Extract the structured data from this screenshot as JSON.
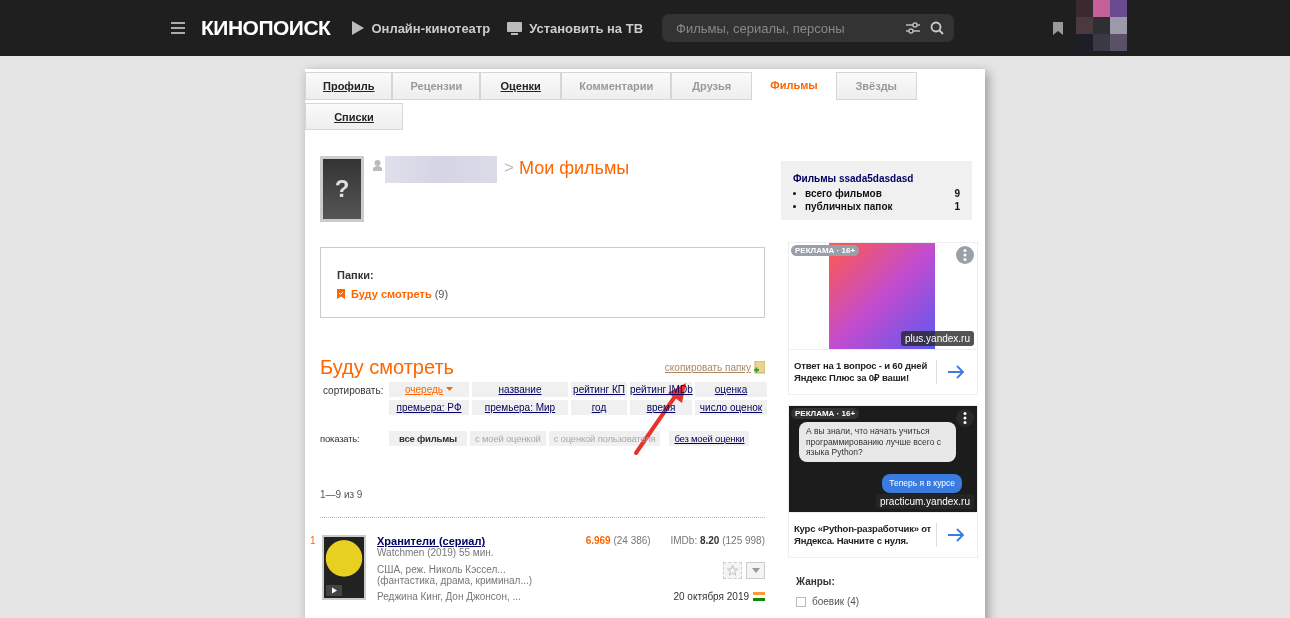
{
  "header": {
    "logo": "КИНОПОИСК",
    "nav": [
      {
        "label": "Онлайн-кинотеатр"
      },
      {
        "label": "Установить на ТВ"
      }
    ],
    "search": {
      "placeholder": "Фильмы, сериалы, персоны"
    }
  },
  "tab_rows": [
    [
      {
        "label": "Профиль",
        "selected": false,
        "disabled": false
      },
      {
        "label": "Рецензии",
        "selected": false,
        "disabled": true
      },
      {
        "label": "Оценки",
        "selected": false,
        "disabled": false
      },
      {
        "label": "Комментарии",
        "selected": false,
        "disabled": true
      },
      {
        "label": "Друзья",
        "selected": false,
        "disabled": true
      },
      {
        "label": "Фильмы",
        "selected": true,
        "disabled": false
      },
      {
        "label": "Звёзды",
        "selected": false,
        "disabled": true
      }
    ],
    [
      {
        "label": "Списки",
        "selected": false,
        "disabled": false
      }
    ]
  ],
  "profile": {
    "avatar_glyph": "?",
    "separator": ">",
    "title": "Мои фильмы"
  },
  "folders": {
    "label": "Папки:",
    "items": [
      {
        "name": "Буду смотреть",
        "count": "(9)"
      }
    ]
  },
  "folder": {
    "title": "Буду смотреть",
    "copy_link": "скопировать папку"
  },
  "sort": {
    "label": "сортировать:",
    "options": [
      {
        "label": "очередь",
        "selected": true
      },
      {
        "label": "название",
        "selected": false
      },
      {
        "label": "рейтинг КП",
        "selected": false
      },
      {
        "label": "рейтинг IMDb",
        "selected": false
      },
      {
        "label": "оценка",
        "selected": false
      },
      {
        "label": "премьера: РФ",
        "selected": false
      },
      {
        "label": "премьера: Мир",
        "selected": false
      },
      {
        "label": "год",
        "selected": false
      },
      {
        "label": "время",
        "selected": false
      },
      {
        "label": "число оценок",
        "selected": false
      }
    ]
  },
  "show": {
    "label": "показать:",
    "options": [
      {
        "label": "все фильмы",
        "selected": true,
        "disabled": false
      },
      {
        "label": "с моей оценкой",
        "selected": false,
        "disabled": true
      },
      {
        "label": "с оценкой пользователя",
        "selected": false,
        "disabled": true
      },
      {
        "label": "без моей оценки",
        "selected": false,
        "disabled": false
      }
    ]
  },
  "pager": "1—9 из 9",
  "films": [
    {
      "number": "1",
      "title": "Хранители (сериал)",
      "original": "Watchmen (2019) 55 мин.",
      "country_director": "США, реж. Николь Кэссел...",
      "genres": "(фантастика, драма, криминал...)",
      "cast": "Реджина Кинг, Дон Джонсон, ...",
      "kp_rating": "6.969",
      "kp_votes": "(24 386)",
      "imdb": "IMDb: **8.20** (125 998)",
      "release_date": "20 октября 2019"
    }
  ],
  "sidebar": {
    "stats": {
      "title": "Фильмы ssada5dasdasd",
      "items": [
        {
          "label": "всего фильмов",
          "value": "9"
        },
        {
          "label": "публичных папок",
          "value": "1"
        }
      ]
    },
    "ads": [
      {
        "kind": "plus",
        "badge": "РЕКЛАМА · 16+",
        "domain": "plus.yandex.ru",
        "text": "Ответ на 1 вопрос - и 60 дней Яндекс Плюс за 0₽ ваши!"
      },
      {
        "kind": "chat",
        "badge": "РЕКЛАМА · 16+",
        "domain": "practicum.yandex.ru",
        "bubbles": [
          "А вы знали, что начать учиться программированию лучше всего с языка Python?",
          "Теперь я в курсе"
        ],
        "text": "Курс «Python-разработчик» от Яндекса. Начните с нуля."
      }
    ],
    "genres": {
      "title": "Жанры:",
      "items": [
        {
          "label": "боевик (4)",
          "checked": false
        }
      ]
    }
  }
}
